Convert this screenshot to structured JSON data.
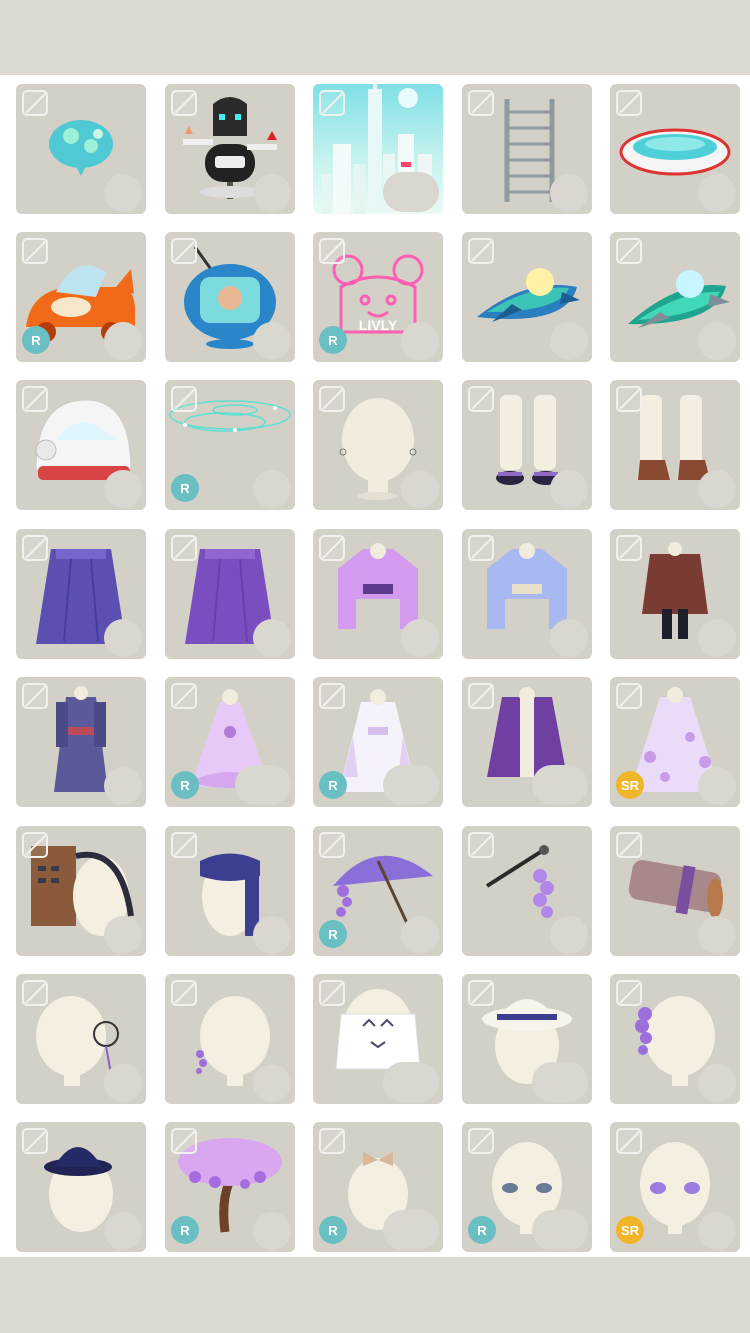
{
  "rarity_labels": {
    "r": "R",
    "sr": "SR"
  },
  "colors": {
    "rarity_r": "#69bfc2",
    "rarity_sr": "#f1b52a",
    "tile_bg": "#d3d0c8"
  },
  "items": [
    {
      "icon": "bubble-lamp-icon",
      "rarity": ""
    },
    {
      "icon": "robot-signpost-icon",
      "rarity": ""
    },
    {
      "icon": "futuristic-city-background-icon",
      "rarity": ""
    },
    {
      "icon": "ladder-icon",
      "rarity": ""
    },
    {
      "icon": "round-pool-icon",
      "rarity": ""
    },
    {
      "icon": "clam-car-icon",
      "rarity": "R"
    },
    {
      "icon": "retro-tv-icon",
      "rarity": ""
    },
    {
      "icon": "livly-neon-sign-icon",
      "rarity": "R"
    },
    {
      "icon": "spaceship-blue-icon",
      "rarity": ""
    },
    {
      "icon": "spaceship-green-icon",
      "rarity": ""
    },
    {
      "icon": "space-helmet-icon",
      "rarity": ""
    },
    {
      "icon": "orbit-sparkle-effect-icon",
      "rarity": "R"
    },
    {
      "icon": "earrings-mannequin-icon",
      "rarity": ""
    },
    {
      "icon": "tabi-sandals-icon",
      "rarity": ""
    },
    {
      "icon": "brown-boots-icon",
      "rarity": ""
    },
    {
      "icon": "purple-hakama-skirt-icon",
      "rarity": ""
    },
    {
      "icon": "violet-hakama-skirt-icon",
      "rarity": ""
    },
    {
      "icon": "purple-kimono-top-icon",
      "rarity": ""
    },
    {
      "icon": "blue-kimono-top-icon",
      "rarity": ""
    },
    {
      "icon": "brown-cape-outfit-icon",
      "rarity": ""
    },
    {
      "icon": "navy-kimono-icon",
      "rarity": ""
    },
    {
      "icon": "lilac-ruffle-dress-icon",
      "rarity": "R"
    },
    {
      "icon": "white-kimono-dress-icon",
      "rarity": "R"
    },
    {
      "icon": "purple-haori-icon",
      "rarity": ""
    },
    {
      "icon": "wisteria-gown-icon",
      "rarity": "SR"
    },
    {
      "icon": "wooden-backpack-icon",
      "rarity": ""
    },
    {
      "icon": "navy-scarf-icon",
      "rarity": ""
    },
    {
      "icon": "wisteria-umbrella-icon",
      "rarity": "R"
    },
    {
      "icon": "wisteria-pipe-icon",
      "rarity": ""
    },
    {
      "icon": "scroll-bag-icon",
      "rarity": ""
    },
    {
      "icon": "monocle-icon",
      "rarity": ""
    },
    {
      "icon": "wisteria-earring-icon",
      "rarity": ""
    },
    {
      "icon": "cat-face-mask-icon",
      "rarity": ""
    },
    {
      "icon": "white-fedora-icon",
      "rarity": ""
    },
    {
      "icon": "wisteria-hair-clip-icon",
      "rarity": ""
    },
    {
      "icon": "navy-bowler-hat-icon",
      "rarity": ""
    },
    {
      "icon": "wisteria-tree-icon",
      "rarity": "R"
    },
    {
      "icon": "hair-ribbon-icon",
      "rarity": "R"
    },
    {
      "icon": "gray-eyes-icon",
      "rarity": "R"
    },
    {
      "icon": "violet-eyes-icon",
      "rarity": "SR"
    }
  ]
}
